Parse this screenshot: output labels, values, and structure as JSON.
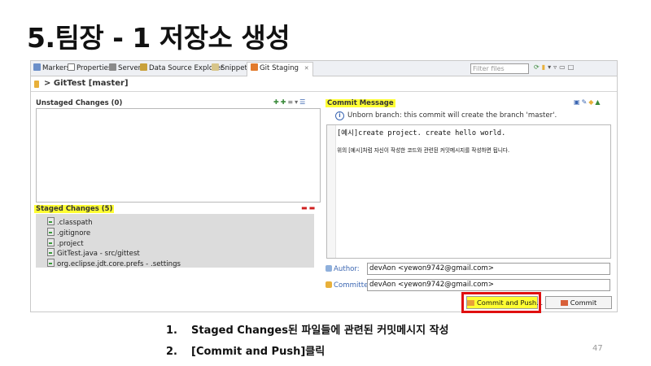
{
  "slide": {
    "title": "5.팀장 - 1 저장소 생성",
    "page_number": "47"
  },
  "ide": {
    "tabs": [
      {
        "label": "Markers",
        "icon": "markers-icon"
      },
      {
        "label": "Properties",
        "icon": "properties-icon"
      },
      {
        "label": "Servers",
        "icon": "servers-icon"
      },
      {
        "label": "Data Source Explorer",
        "icon": "data-source-icon"
      },
      {
        "label": "Snippets",
        "icon": "snippets-icon"
      },
      {
        "label": "Git Staging",
        "icon": "git-staging-icon"
      }
    ],
    "tab_close": "✕",
    "filter_placeholder": "Filter files",
    "repo_title": "> GitTest [master]",
    "unstaged": {
      "title": "Unstaged Changes (0)"
    },
    "staged": {
      "title": "Staged Changes (5)",
      "items": [
        ".classpath",
        ".gitignore",
        ".project",
        "GitTest.java - src/gittest",
        "org.eclipse.jdt.core.prefs - .settings"
      ]
    },
    "commit": {
      "title": "Commit Message",
      "info": "Unborn branch: this commit will create the branch 'master'.",
      "message_line1": "[예시]create project. create hello world.",
      "message_line2": "위의 [예시]처럼 자신이 작성한 코드와 관련된 커밋메시지를 작성하면 됩니다.",
      "author_label": "Author:",
      "author_value": "devAon <yewon9742@gmail.com>",
      "committer_label": "Committer:",
      "committer_value": "devAon <yewon9742@gmail.com>",
      "commit_push_label": "Commit and Push...",
      "commit_label": "Commit"
    }
  },
  "steps": [
    {
      "num": "1.",
      "text": "Staged Changes된 파일들에 관련된 커밋메시지 작성"
    },
    {
      "num": "2.",
      "text": "[Commit and Push]클릭"
    }
  ],
  "colors": {
    "highlight": "#ffff33",
    "annotation_red": "#e01010",
    "label_blue": "#3b66b2"
  }
}
